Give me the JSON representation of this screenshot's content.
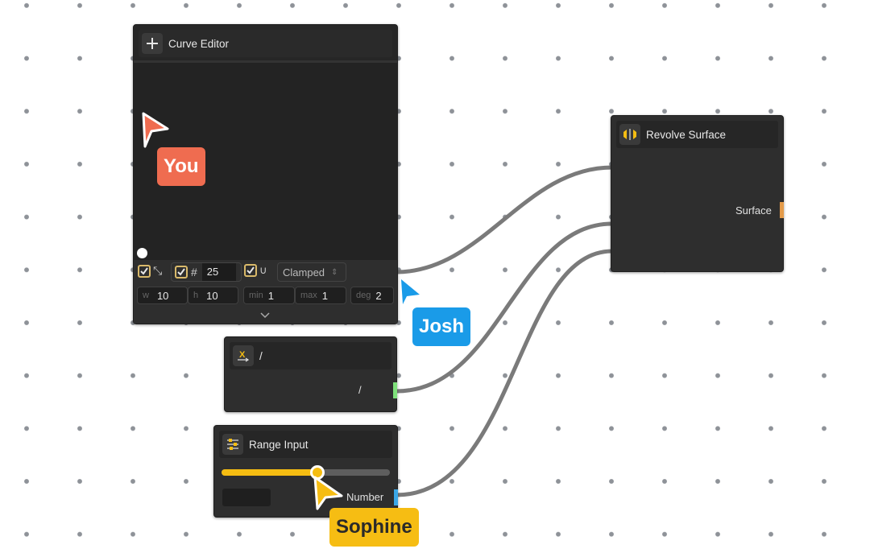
{
  "canvas": {
    "background": "#ffffff",
    "dot_color": "#8e9298"
  },
  "nodes": {
    "curve_editor": {
      "title": "Curve Editor",
      "icon": "plus-icon",
      "toolbar": {
        "toggle_smooth_checked": true,
        "toggle_grid_checked": true,
        "grid_value": "25",
        "toggle_snap_checked": true,
        "mode_select": "Clamped",
        "fields": [
          {
            "label": "w",
            "value": "10"
          },
          {
            "label": "h",
            "value": "10"
          },
          {
            "label": "min",
            "value": "1"
          },
          {
            "label": "max",
            "value": "1"
          },
          {
            "label": "deg",
            "value": "2"
          }
        ],
        "expand_icon": "chevron-down-icon"
      }
    },
    "division": {
      "title": "/",
      "icon": "x-arrow-icon",
      "output_label": "/",
      "port_color": "#7ee07a"
    },
    "range_input": {
      "title": "Range Input",
      "icon": "sliders-icon",
      "output_label": "Number",
      "port_color": "#3aa7e8",
      "slider_fraction": 0.57,
      "slider_color": "#f5bd12",
      "value_field": ""
    },
    "revolve_surface": {
      "title": "Revolve Surface",
      "icon": "revolve-icon",
      "output_label": "Surface",
      "port_color": "#e49b4a"
    }
  },
  "cursors": [
    {
      "name": "You",
      "color": "#ef6c50"
    },
    {
      "name": "Josh",
      "color": "#1a9be8"
    },
    {
      "name": "Sophine",
      "color": "#f6bd13"
    }
  ]
}
